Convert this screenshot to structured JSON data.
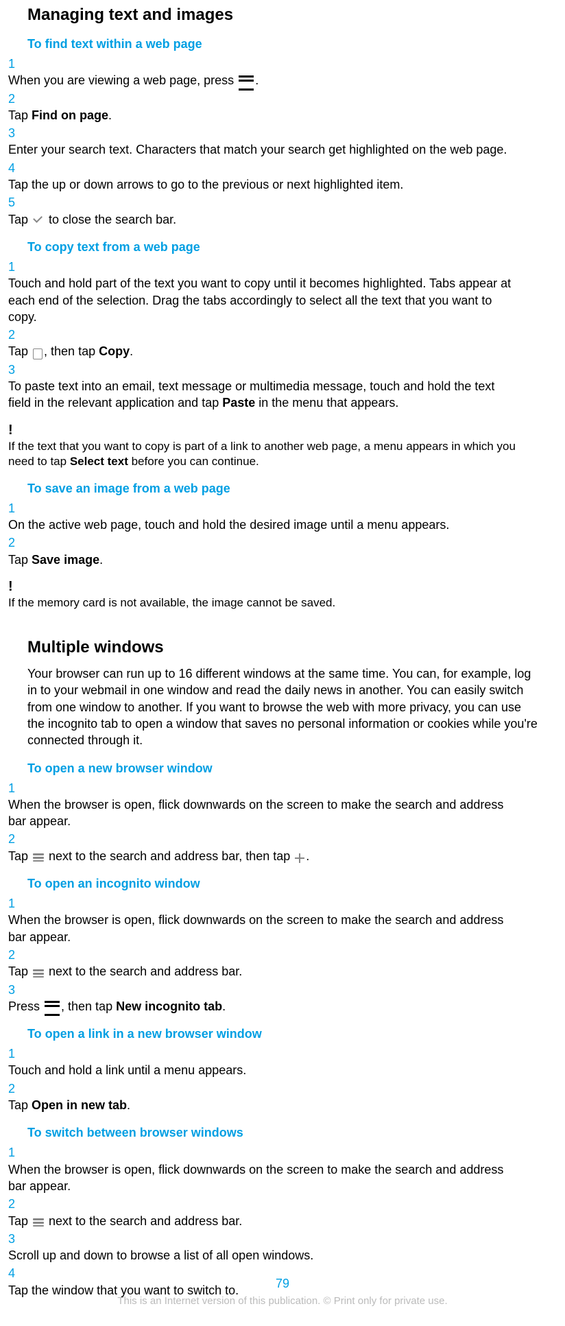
{
  "heading1": "Managing text and images",
  "sec1": {
    "title": "To find text within a web page",
    "steps": [
      {
        "n": "1",
        "pre": "When you are viewing a web page, press ",
        "icon": "menu",
        "post": "."
      },
      {
        "n": "2",
        "pre": "Tap ",
        "bold": "Find on page",
        "post": "."
      },
      {
        "n": "3",
        "text": "Enter your search text. Characters that match your search get highlighted on the web page."
      },
      {
        "n": "4",
        "text": "Tap the up or down arrows to go to the previous or next highlighted item."
      },
      {
        "n": "5",
        "pre": "Tap ",
        "icon": "check",
        "post": " to close the search bar."
      }
    ]
  },
  "sec2": {
    "title": "To copy text from a web page",
    "steps": [
      {
        "n": "1",
        "text": "Touch and hold part of the text you want to copy until it becomes highlighted. Tabs appear at each end of the selection. Drag the tabs accordingly to select all the text that you want to copy."
      },
      {
        "n": "2",
        "pre": "Tap ",
        "icon": "copy",
        "mid": ", then tap ",
        "bold": "Copy",
        "post": "."
      },
      {
        "n": "3",
        "pre": "To paste text into an email, text message or multimedia message, touch and hold the text field in the relevant application and tap ",
        "bold": "Paste",
        "post": " in the menu that appears."
      }
    ],
    "note": {
      "pre": "If the text that you want to copy is part of a link to another web page, a menu appears in which you need to tap ",
      "bold": "Select text",
      "post": " before you can continue."
    }
  },
  "sec3": {
    "title": "To save an image from a web page",
    "steps": [
      {
        "n": "1",
        "text": "On the active web page, touch and hold the desired image until a menu appears."
      },
      {
        "n": "2",
        "pre": "Tap ",
        "bold": "Save image",
        "post": "."
      }
    ],
    "note": {
      "text": "If the memory card is not available, the image cannot be saved."
    }
  },
  "heading2": "Multiple windows",
  "intro2": "Your browser can run up to 16 different windows at the same time. You can, for example, log in to your webmail in one window and read the daily news in another. You can easily switch from one window to another. If you want to browse the web with more privacy, you can use the incognito tab to open a window that saves no personal information or cookies while you're connected through it.",
  "sec4": {
    "title": "To open a new browser window",
    "steps": [
      {
        "n": "1",
        "text": "When the browser is open, flick downwards on the screen to make the search and address bar appear."
      },
      {
        "n": "2",
        "pre": "Tap ",
        "icon": "windows",
        "mid": " next to the search and address bar, then tap ",
        "icon2": "plus",
        "post": "."
      }
    ]
  },
  "sec5": {
    "title": "To open an incognito window",
    "steps": [
      {
        "n": "1",
        "text": "When the browser is open, flick downwards on the screen to make the search and address bar appear."
      },
      {
        "n": "2",
        "pre": "Tap ",
        "icon": "windows",
        "post": " next to the search and address bar."
      },
      {
        "n": "3",
        "pre": "Press ",
        "icon": "menu",
        "mid": ", then tap ",
        "bold": "New incognito tab",
        "post": "."
      }
    ]
  },
  "sec6": {
    "title": "To open a link in a new browser window",
    "steps": [
      {
        "n": "1",
        "text": "Touch and hold a link until a menu appears."
      },
      {
        "n": "2",
        "pre": "Tap ",
        "bold": "Open in new tab",
        "post": "."
      }
    ]
  },
  "sec7": {
    "title": "To switch between browser windows",
    "steps": [
      {
        "n": "1",
        "text": "When the browser is open, flick downwards on the screen to make the search and address bar appear."
      },
      {
        "n": "2",
        "pre": "Tap ",
        "icon": "windows",
        "post": " next to the search and address bar."
      },
      {
        "n": "3",
        "text": "Scroll up and down to browse a list of all open windows."
      },
      {
        "n": "4",
        "text": "Tap the window that you want to switch to."
      }
    ]
  },
  "page_number": "79",
  "disclaimer": "This is an Internet version of this publication. © Print only for private use."
}
